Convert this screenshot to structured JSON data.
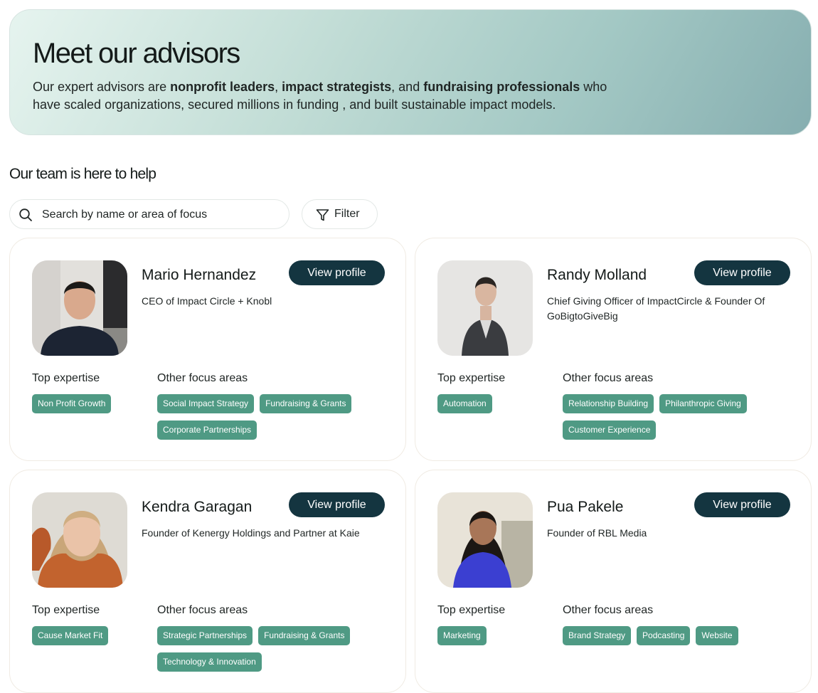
{
  "hero": {
    "title": "Meet our advisors",
    "desc_1": "Our expert advisors are ",
    "highlight_1": "nonprofit leaders",
    "desc_2": ", ",
    "highlight_2": "impact strategists",
    "desc_3": ", and ",
    "highlight_3": "fundraising professionals",
    "desc_4": " who have scaled organizations, secured millions in funding , and built sustainable impact models."
  },
  "section_title": "Our team is here to help",
  "search": {
    "placeholder": "Search by name or area of focus",
    "icon": "search-icon"
  },
  "filter": {
    "label": "Filter",
    "icon": "filter-icon"
  },
  "advisors": [
    {
      "name": "Mario Hernandez",
      "role": "CEO of Impact Circle + Knobl",
      "button": "View profile",
      "top_label": "Top expertise",
      "other_label": "Other focus areas",
      "top": [
        "Non Profit Growth"
      ],
      "other": [
        "Social Impact Strategy",
        "Fundraising & Grants",
        "Corporate Partnerships"
      ]
    },
    {
      "name": "Randy Molland",
      "role": "Chief Giving Officer of ImpactCircle & Founder Of GoBigtoGiveBig",
      "button": "View profile",
      "top_label": "Top expertise",
      "other_label": "Other focus areas",
      "top": [
        "Automation"
      ],
      "other": [
        "Relationship Building",
        "Philanthropic Giving",
        "Customer Experience"
      ]
    },
    {
      "name": "Kendra Garagan",
      "role": "Founder of Kenergy Holdings and Partner at Kaie",
      "button": "View profile",
      "top_label": "Top expertise",
      "other_label": "Other focus areas",
      "top": [
        "Cause Market Fit"
      ],
      "other": [
        "Strategic Partnerships",
        "Fundraising & Grants",
        "Technology & Innovation"
      ]
    },
    {
      "name": "Pua Pakele",
      "role": "Founder of RBL Media",
      "button": "View profile",
      "top_label": "Top expertise",
      "other_label": "Other focus areas",
      "top": [
        "Marketing"
      ],
      "other": [
        "Brand Strategy",
        "Podcasting",
        "Website"
      ]
    }
  ],
  "colors": {
    "button_bg": "#143540",
    "tag_bg": "#4f9a84",
    "hero_gradient_start": "#e6f4ef",
    "hero_gradient_end": "#86aeb0"
  }
}
